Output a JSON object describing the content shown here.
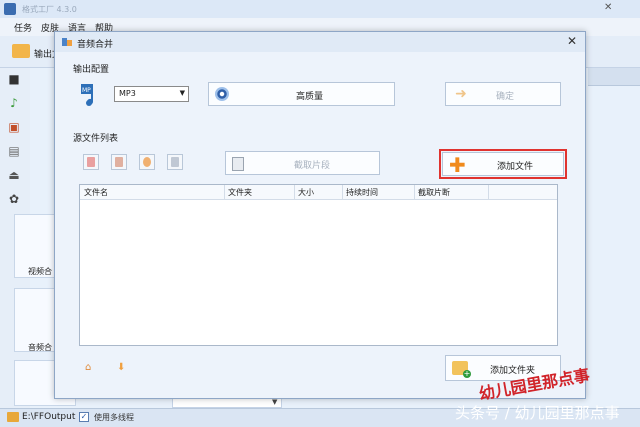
{
  "background": {
    "window_title": "格式工厂 4.3.0",
    "menu": [
      "任务",
      "皮肤",
      "语言",
      "帮助"
    ],
    "output_folder_label": "输出文",
    "panels": [
      "视频合",
      "音频合"
    ],
    "status_path": "E:\\FFOutput",
    "status_option": "使用多线程"
  },
  "dialog": {
    "title": "音频合并",
    "output_config_label": "输出配置",
    "format_value": "MP3",
    "quality_button": "高质量",
    "confirm_button": "确定",
    "source_list_label": "源文件列表",
    "clip_button": "截取片段",
    "add_file_button": "添加文件",
    "add_folder_button": "添加文件夹",
    "columns": [
      "文件名",
      "文件夹",
      "大小",
      "持续时间",
      "截取片断"
    ]
  },
  "watermark": {
    "red_text": "幼儿园里那点事",
    "white_text": "头条号 / 幼儿园里那点事"
  }
}
